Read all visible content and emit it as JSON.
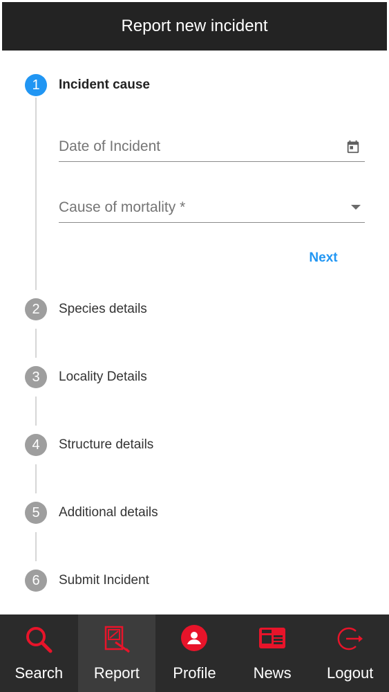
{
  "header": {
    "title": "Report new incident"
  },
  "steps": [
    {
      "number": "1",
      "label": "Incident cause",
      "active": true
    },
    {
      "number": "2",
      "label": "Species details",
      "active": false
    },
    {
      "number": "3",
      "label": "Locality Details",
      "active": false
    },
    {
      "number": "4",
      "label": "Structure details",
      "active": false
    },
    {
      "number": "5",
      "label": "Additional details",
      "active": false
    },
    {
      "number": "6",
      "label": "Submit Incident",
      "active": false
    }
  ],
  "form": {
    "date_placeholder": "Date of Incident",
    "date_value": "",
    "cause_placeholder": "Cause of mortality *",
    "next_label": "Next"
  },
  "bottom_nav": {
    "items": [
      {
        "label": "Search",
        "icon": "search-icon",
        "active": false
      },
      {
        "label": "Report",
        "icon": "report-icon",
        "active": true
      },
      {
        "label": "Profile",
        "icon": "profile-icon",
        "active": false
      },
      {
        "label": "News",
        "icon": "news-icon",
        "active": false
      },
      {
        "label": "Logout",
        "icon": "logout-icon",
        "active": false
      }
    ]
  },
  "colors": {
    "accent": "#2196f3",
    "nav_icon": "#e8142a",
    "header_bg": "#232323",
    "nav_bg": "#2b2b2b",
    "inactive_step": "#9e9e9e"
  }
}
